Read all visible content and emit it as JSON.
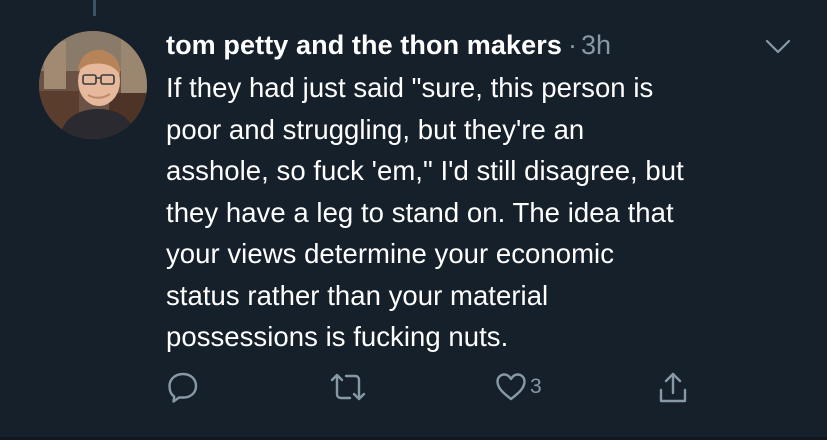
{
  "tweet": {
    "author_name": "tom petty and the thon makers",
    "separator": "·",
    "timestamp": "3h",
    "body_lines": [
      "If they had just said \"sure, this person is",
      "poor and struggling, but they're an",
      "asshole, so fuck 'em,\" I'd still disagree, but",
      "they have a leg to stand on. The idea that",
      "your views determine your economic",
      "status rather than your material",
      "possessions is fucking nuts."
    ],
    "like_count": "3"
  },
  "icons": {
    "menu": "chevron-down-icon",
    "reply": "reply-icon",
    "retweet": "retweet-icon",
    "like": "heart-icon",
    "share": "share-icon"
  },
  "colors": {
    "background": "#15202b",
    "text_primary": "#ffffff",
    "text_secondary": "#8899a6",
    "thread_line": "#3d5466"
  }
}
